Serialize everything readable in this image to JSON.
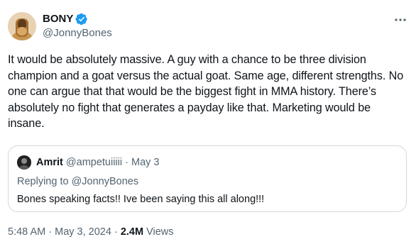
{
  "author": {
    "display_name": "BONY",
    "handle": "@JonnyBones",
    "verified_icon": "verified-badge-icon",
    "more_icon": "more-options-icon"
  },
  "tweet": {
    "text": "It would be absolutely massive. A guy with a chance to be three division champion and a goat versus the actual goat. Same age, different strengths. No one can argue that that would be the biggest fight in MMA history. There’s absolutely no fight that generates a payday like that. Marketing would be insane."
  },
  "quote": {
    "display_name": "Amrit",
    "handle": "@ampetuiiiii",
    "separator": "·",
    "date": "May 3",
    "replying_prefix": "Replying to",
    "replying_to": "@JonnyBones",
    "text": "Bones speaking facts!! Ive been saying this all along!!!"
  },
  "footer": {
    "time": "5:48 AM",
    "separator": "·",
    "date": "May 3, 2024",
    "views_count": "2.4M",
    "views_label": "Views"
  },
  "colors": {
    "verified": "#1d9bf0",
    "text_primary": "#0f1419",
    "text_secondary": "#536471",
    "border": "#cfd9de"
  }
}
